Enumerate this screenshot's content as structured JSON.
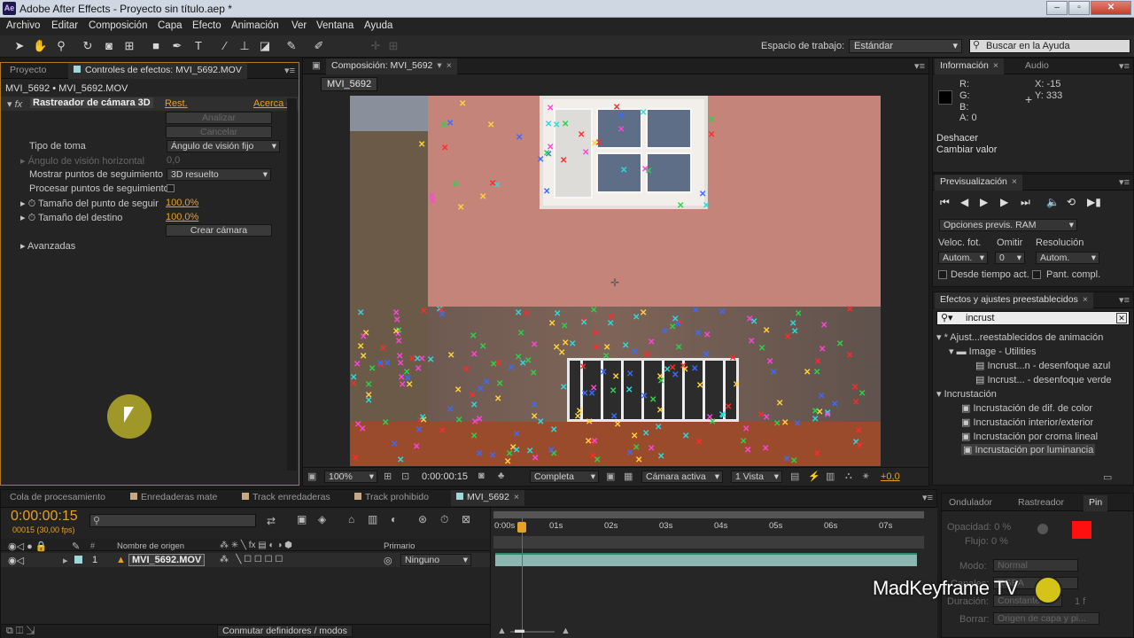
{
  "window": {
    "title": "Adobe After Effects - Proyecto sin título.aep *",
    "logo": "Ae",
    "min": "–",
    "max": "▫",
    "close": "✕"
  },
  "menu": [
    "Archivo",
    "Editar",
    "Composición",
    "Capa",
    "Efecto",
    "Animación",
    "Ver",
    "Ventana",
    "Ayuda"
  ],
  "toolbar": {
    "workspace_label": "Espacio de trabajo:",
    "workspace_value": "Estándar",
    "help_placeholder": "Buscar en la Ayuda"
  },
  "left_panel": {
    "tab_project": "Proyecto",
    "tab_effects": "Controles de efectos: MVI_5692.MOV",
    "breadcrumb": "MVI_5692 • MVI_5692.MOV",
    "effect_name": "Rastreador de cámara 3D",
    "reset": "Rest.",
    "about": "Acerca d",
    "analyze": "Analizar",
    "cancel": "Cancelar",
    "shot_type_label": "Tipo de toma",
    "shot_type_value": "Ángulo de visión fijo",
    "hfov_label": "Ángulo de visión horizontal",
    "hfov_value": "0,0",
    "show_points_label": "Mostrar puntos de seguimiento",
    "show_points_value": "3D resuelto",
    "render_points_label": "Procesar puntos de seguimiento",
    "point_size_label": "Tamaño del punto de seguir",
    "point_size_value": "100,0%",
    "target_size_label": "Tamaño del destino",
    "target_size_value": "100,0%",
    "create_camera": "Crear cámara",
    "advanced": "Avanzadas"
  },
  "composition": {
    "tab": "Composición: MVI_5692",
    "comp_label": "MVI_5692",
    "zoom": "100%",
    "timecode": "0:00:00:15",
    "resolution": "Completa",
    "camera": "Cámara activa",
    "views": "1 Vista",
    "exposure": "+0,0"
  },
  "info": {
    "tab_info": "Información",
    "tab_audio": "Audio",
    "r": "R:",
    "g": "G:",
    "b": "B:",
    "a": "A:  0",
    "x": "X:  -15",
    "y": "Y:  333",
    "undo": "Deshacer",
    "undo_action": "Cambiar valor"
  },
  "preview": {
    "tab": "Previsualización",
    "ram_options": "Opciones previs. RAM",
    "fps_label": "Veloc. fot.",
    "skip_label": "Omitir",
    "res_label": "Resolución",
    "fps_value": "Autom.",
    "skip_value": "0",
    "res_value": "Autom.",
    "from_current": "Desde tiempo act.",
    "fullscreen": "Pant. compl."
  },
  "effects_presets": {
    "tab": "Efectos y ajustes preestablecidos",
    "search": "incrust",
    "items": [
      "* Ajust...reestablecidos de animación",
      "Image - Utilities",
      "Incrust...n - desenfoque azul",
      "Incrust... - desenfoque verde",
      "Incrustación",
      "Incrustación de dif. de color",
      "Incrustación interior/exterior",
      "Incrustación por croma lineal",
      "Incrustación por luminancia"
    ]
  },
  "timeline": {
    "tabs": [
      "Cola de procesamiento",
      "Enredaderas mate",
      "Track enredaderas",
      "Track prohibido",
      "MVI_5692"
    ],
    "timecode": "0:00:00:15",
    "fps": "00015 (30,00 fps)",
    "col_source": "Nombre de origen",
    "col_hash": "#",
    "col_parent": "Primario",
    "layer_num": "1",
    "layer_name": "MVI_5692.MOV",
    "parent_value": "Ninguno",
    "toggle_modes": "Conmutar definidores / modos",
    "ruler": [
      "0:00s",
      "01s",
      "02s",
      "03s",
      "04s",
      "05s",
      "06s",
      "07s"
    ],
    "current_time_fraction": 0.064
  },
  "paragraph": {
    "tab_wiggle": "Ondulador",
    "tab_smoother": "Rastreador",
    "tab_paint": "Pin",
    "opacity": "Opacidad: 0 %",
    "flow": "Flujo: 0 %",
    "mode_label": "Modo:",
    "mode_value": "Normal",
    "channels_label": "Canales:",
    "channels_value": "RGBA",
    "duration_label": "Duración:",
    "duration_value": "Constante",
    "duration_num": "1 f",
    "erase_label": "Borrar:",
    "erase_value": "Origen de capa y pi..."
  },
  "watermark": "MadKeyframe TV",
  "colors": {
    "accent": "#e8a027",
    "fg_swatch": "#ff1010",
    "bg_swatch": "#ffffff"
  },
  "icons": [
    "selection-icon",
    "hand-icon",
    "zoom-icon",
    "rotate-icon",
    "camera-icon",
    "pan-icon",
    "rectangle-icon",
    "pen-icon",
    "text-icon",
    "brush-icon",
    "stamp-icon",
    "eraser-icon",
    "roto-icon",
    "puppet-icon",
    "search-icon",
    "play-icon",
    "close-icon"
  ]
}
